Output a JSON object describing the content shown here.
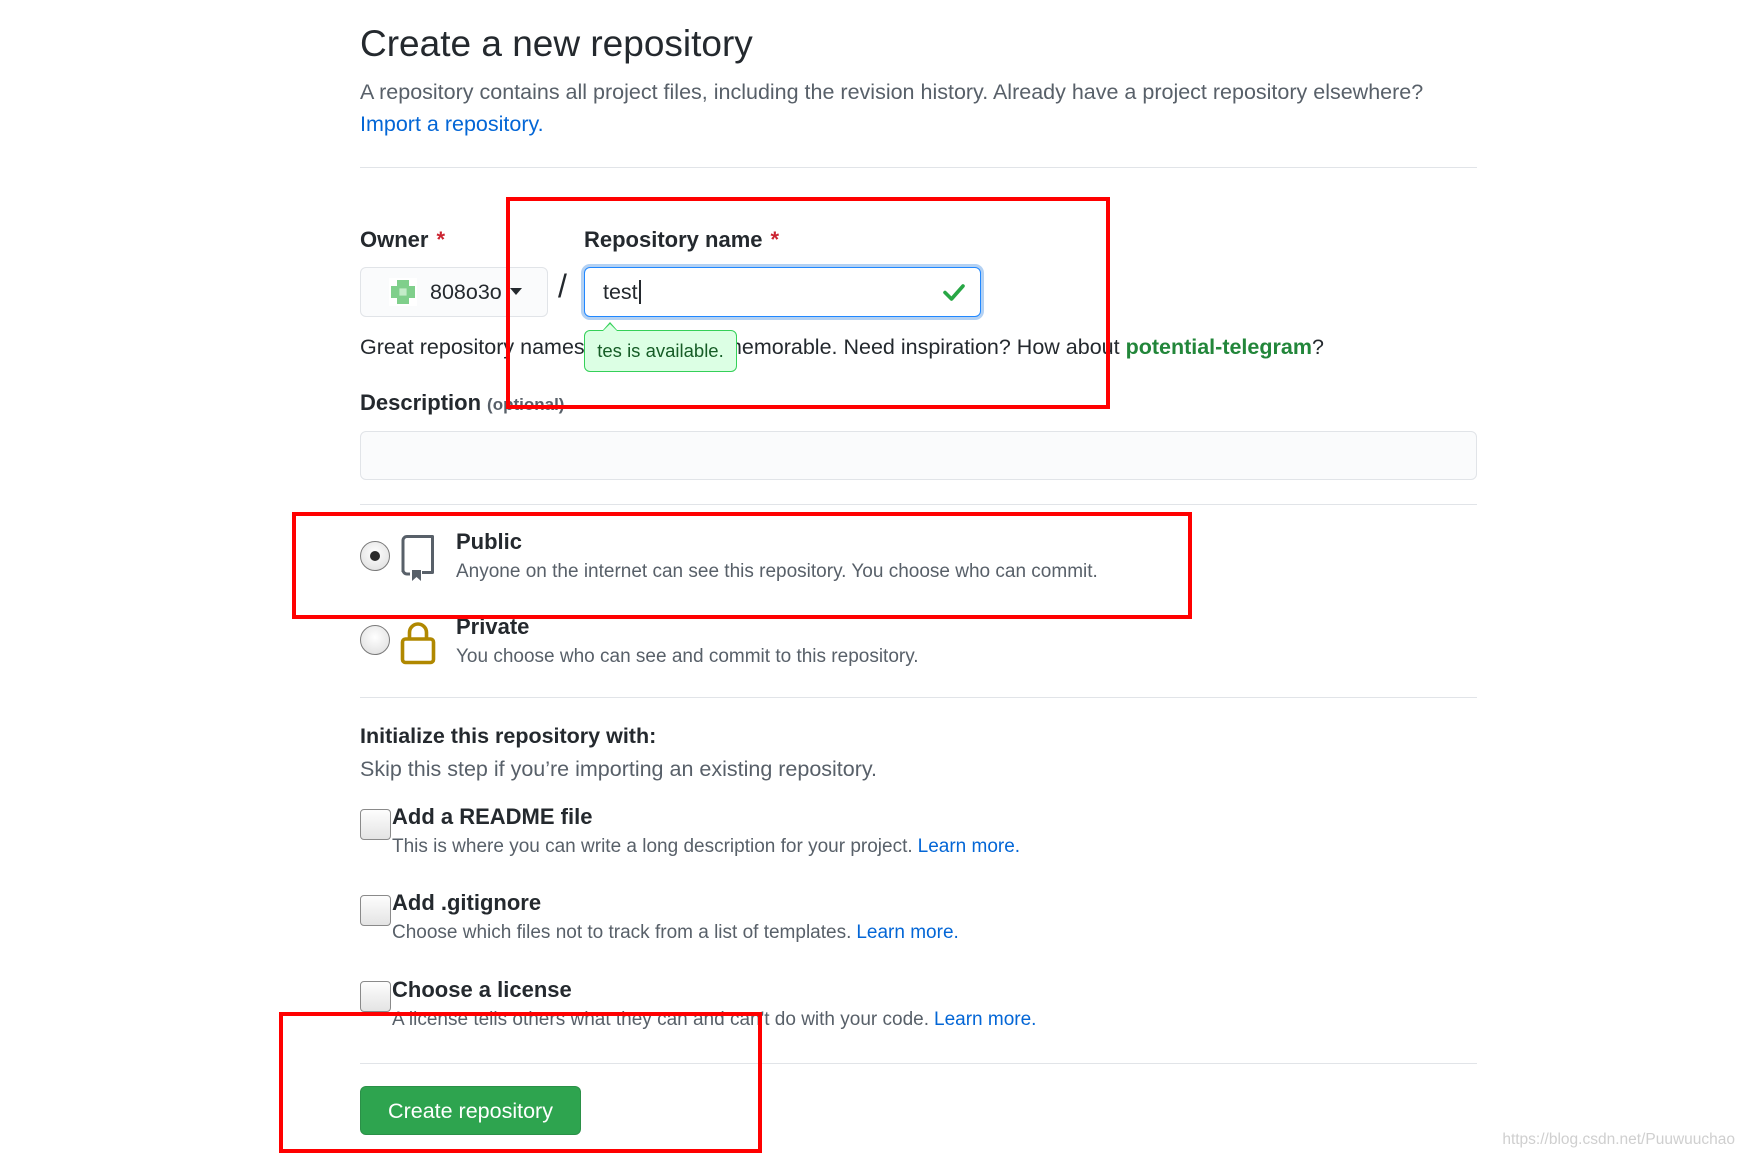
{
  "page": {
    "title": "Create a new repository",
    "subtitle": "A repository contains all project files, including the revision history. Already have a project repository elsewhere?",
    "import_link": "Import a repository."
  },
  "owner": {
    "label": "Owner",
    "required_mark": "*",
    "value": "808o3o",
    "avatar_icon": "identicon-avatar",
    "dropdown_icon": "caret-down-icon"
  },
  "path_separator": "/",
  "repository_name": {
    "label": "Repository name",
    "required_mark": "*",
    "value": "test",
    "status_icon": "check-icon",
    "tooltip": "tes is available."
  },
  "name_hint": {
    "before": "Great repository names",
    "after": "memorable. Need inspiration? How about",
    "suggestion": "potential-telegram",
    "end": "?"
  },
  "description": {
    "label": "Description",
    "optional_note": "(optional)",
    "value": ""
  },
  "visibility": {
    "selected": "public",
    "options": [
      {
        "id": "public",
        "label": "Public",
        "description": "Anyone on the internet can see this repository. You choose who can commit.",
        "icon": "repo-icon"
      },
      {
        "id": "private",
        "label": "Private",
        "description": "You choose who can see and commit to this repository.",
        "icon": "lock-icon"
      }
    ]
  },
  "initialize": {
    "heading": "Initialize this repository with:",
    "subtext": "Skip this step if you’re importing an existing repository.",
    "options": [
      {
        "label": "Add a README file",
        "description": "This is where you can write a long description for your project.",
        "link": "Learn more.",
        "checked": false
      },
      {
        "label": "Add .gitignore",
        "description": "Choose which files not to track from a list of templates.",
        "link": "Learn more.",
        "checked": false
      },
      {
        "label": "Choose a license",
        "description": "A license tells others what they can and can't do with your code.",
        "link": "Learn more.",
        "checked": false
      }
    ]
  },
  "submit": {
    "label": "Create repository"
  },
  "watermark": "https://blog.csdn.net/Puuwuuchao",
  "colors": {
    "text": "#24292e",
    "muted": "#586069",
    "link": "#0366d6",
    "required": "#cb2431",
    "success": "#28a745",
    "suggestion": "#22863a",
    "focus_border": "#2188ff",
    "button_bg": "#2ea44f",
    "tooltip_bg": "#dcffe4",
    "tooltip_border": "#34d058",
    "lock": "#b08800",
    "annotation": "#ff0000",
    "watermark": "#cfcfcf"
  }
}
